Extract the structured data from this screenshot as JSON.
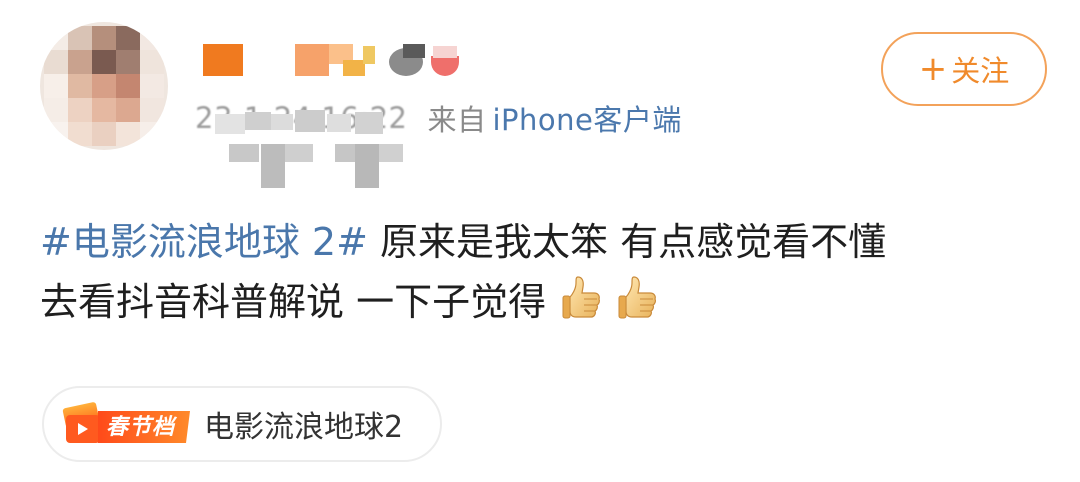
{
  "post": {
    "time": "23-1-24 16:22",
    "from_label": "来自",
    "device": "iPhone客户端",
    "hashtag": "#电影流浪地球 2#",
    "text_line1": " 原来是我太笨  有点感觉看不懂",
    "text_line2": "去看抖音科普解说 一下子觉得",
    "emoji": [
      "thumbs-up",
      "thumbs-up"
    ]
  },
  "follow": {
    "plus": "+",
    "label": "关注"
  },
  "topic_chip": {
    "badge": "春节档",
    "label": "电影流浪地球2"
  },
  "colors": {
    "link_blue": "#4a77ab",
    "follow_orange": "#f08a2b",
    "follow_border": "#f3a25a",
    "meta_gray": "#9b9b9b",
    "badge_orange": "#ff6a1a"
  }
}
